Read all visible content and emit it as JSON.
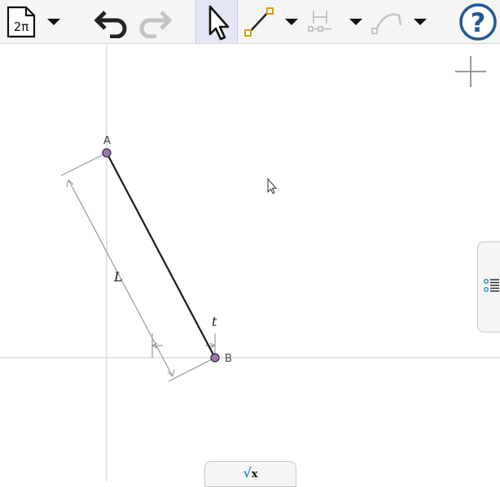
{
  "toolbar": {
    "rounding_label": "2π",
    "icons": {
      "file_menu": "file-2pi-icon",
      "undo": "undo-icon",
      "redo": "redo-icon",
      "move": "cursor-arrow-icon",
      "segment": "segment-tool-icon",
      "measure": "measure-tool-icon",
      "curve": "curve-tool-icon",
      "help": "help-icon"
    },
    "help_label": "?"
  },
  "graphics": {
    "points": [
      {
        "name": "A"
      },
      {
        "name": "B"
      }
    ],
    "length_label": "L",
    "tick_label": "t"
  },
  "input_bar": {
    "label_radical": "√",
    "label_x": "x"
  },
  "colors": {
    "toolbar_bg": "#f5f5f5",
    "point_fill": "#a074b0",
    "segment": "#1a1a1a",
    "axis": "#cccccc",
    "help_blue": "#1f5a96",
    "active_tool_bg": "#e3e6f5"
  }
}
